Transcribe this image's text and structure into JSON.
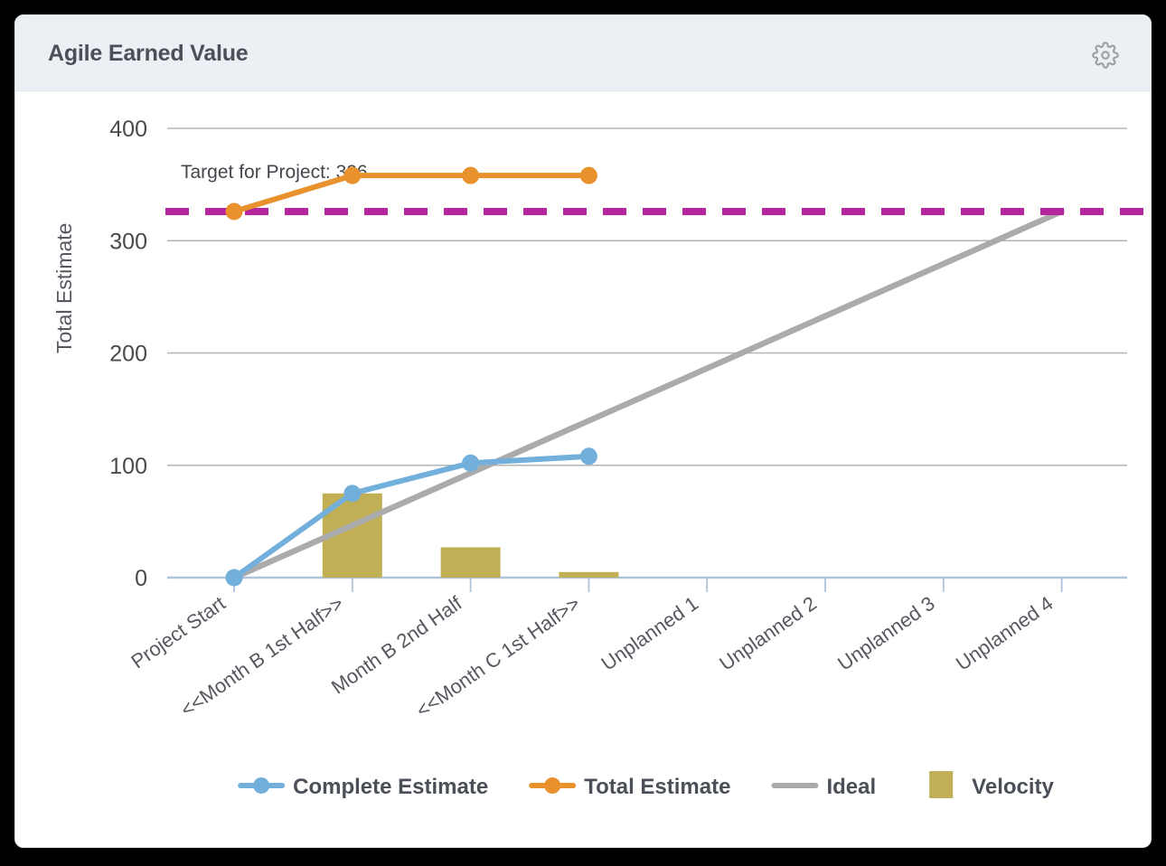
{
  "card": {
    "title": "Agile Earned Value",
    "settings_icon": "gear-icon"
  },
  "chart_data": {
    "type": "line",
    "title": "Agile Earned Value",
    "xlabel": "",
    "ylabel": "Total Estimate",
    "ylim": [
      0,
      400
    ],
    "yticks": [
      0,
      100,
      200,
      300,
      400
    ],
    "ytick_labels": [
      "0",
      "100",
      "200",
      "300",
      "400"
    ],
    "grid": true,
    "legend_position": "bottom",
    "categories": [
      "Project Start",
      "<<Month B 1st Half>>",
      "Month B 2nd Half",
      "<<Month C 1st Half>>",
      "Unplanned 1",
      "Unplanned 2",
      "Unplanned 3",
      "Unplanned 4"
    ],
    "series": [
      {
        "name": "Complete Estimate",
        "type": "line",
        "color": "#72AFDB",
        "marker": "circle",
        "values": [
          0,
          75,
          102,
          108,
          null,
          null,
          null,
          null
        ]
      },
      {
        "name": "Total Estimate",
        "type": "line",
        "color": "#E8912D",
        "marker": "circle",
        "values": [
          326,
          358,
          358,
          358,
          null,
          null,
          null,
          null
        ]
      },
      {
        "name": "Ideal",
        "type": "line",
        "color": "#ABABAB",
        "marker": "none",
        "values": [
          0,
          46.6,
          93.1,
          139.7,
          186.3,
          232.9,
          279.4,
          326
        ]
      },
      {
        "name": "Velocity",
        "type": "bar",
        "color": "#C0AF54",
        "values": [
          null,
          75,
          27,
          5,
          null,
          null,
          null,
          null
        ]
      }
    ],
    "annotations": [
      {
        "name": "target-line",
        "label": "Target for Project: 326",
        "value": 326,
        "color": "#B5259C",
        "style": "dashed-horizontal"
      }
    ]
  },
  "legend": {
    "items": [
      {
        "label": "Complete Estimate",
        "color": "#72AFDB",
        "marker": "line-dot"
      },
      {
        "label": "Total Estimate",
        "color": "#E8912D",
        "marker": "line-dot"
      },
      {
        "label": "Ideal",
        "color": "#ABABAB",
        "marker": "line"
      },
      {
        "label": "Velocity",
        "color": "#C0AF54",
        "marker": "square"
      }
    ]
  }
}
